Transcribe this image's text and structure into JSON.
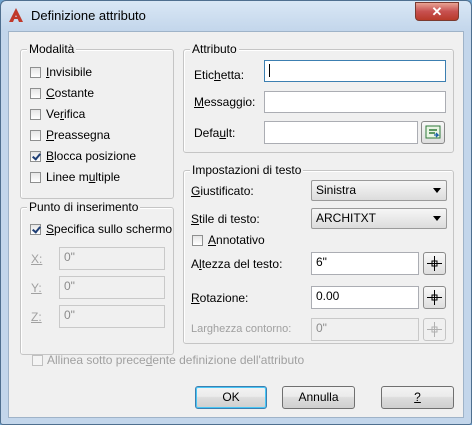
{
  "window": {
    "title": "Definizione attributo",
    "close_glyph": "✕",
    "app_icon": "autocad-icon",
    "accent_color": "#c0392b"
  },
  "modalita": {
    "title": "Modalità",
    "items": [
      {
        "pre": "",
        "key": "I",
        "post": "nvisibile",
        "checked": false
      },
      {
        "pre": "",
        "key": "C",
        "post": "ostante",
        "checked": false
      },
      {
        "pre": "Ve",
        "key": "r",
        "post": "ifica",
        "checked": false
      },
      {
        "pre": "",
        "key": "P",
        "post": "reassegna",
        "checked": false
      },
      {
        "pre": "",
        "key": "B",
        "post": "locca posizione",
        "checked": true
      },
      {
        "pre": "Linee m",
        "key": "u",
        "post": "ltiple",
        "checked": false
      }
    ]
  },
  "insertion": {
    "title": "Punto di inserimento",
    "specify": {
      "pre": "",
      "key": "S",
      "post": "pecifica sullo schermo",
      "checked": true
    },
    "x_label": "X:",
    "x_value": "0\"",
    "y_label": "Y:",
    "y_value": "0\"",
    "z_label": "Z:",
    "z_value": "0\""
  },
  "attribute": {
    "title": "Attributo",
    "tag_label_pre": "Etic",
    "tag_label_key": "h",
    "tag_label_post": "etta:",
    "tag_value": "",
    "prompt_label_pre": "",
    "prompt_label_key": "M",
    "prompt_label_post": "essaggio:",
    "prompt_value": "",
    "default_label_pre": "Defa",
    "default_label_key": "u",
    "default_label_post": "lt:",
    "default_value": "",
    "field_button_icon": "insert-field-icon"
  },
  "text_settings": {
    "title": "Impostazioni di testo",
    "justify_label_pre": "",
    "justify_label_key": "G",
    "justify_label_post": "iustificato:",
    "justify_value": "Sinistra",
    "style_label_pre": "",
    "style_label_key": "S",
    "style_label_post": "tile di testo:",
    "style_value": "ARCHITXT",
    "annotative_pre": "",
    "annotative_key": "A",
    "annotative_post": "nnotativo",
    "annotative_checked": false,
    "height_label_pre": "A",
    "height_label_key": "l",
    "height_label_post": "tezza del testo:",
    "height_value": "6\"",
    "rotation_label_pre": "",
    "rotation_label_key": "R",
    "rotation_label_post": "otazione:",
    "rotation_value": "0.00",
    "width_label": "Larghezza contorno:",
    "width_value": "0\""
  },
  "align_below": {
    "pre": "Allinea sotto prece",
    "key": "d",
    "post": "ente definizione dell'attributo",
    "checked": false
  },
  "buttons": {
    "ok": "OK",
    "cancel": "Annulla",
    "help": "?"
  }
}
